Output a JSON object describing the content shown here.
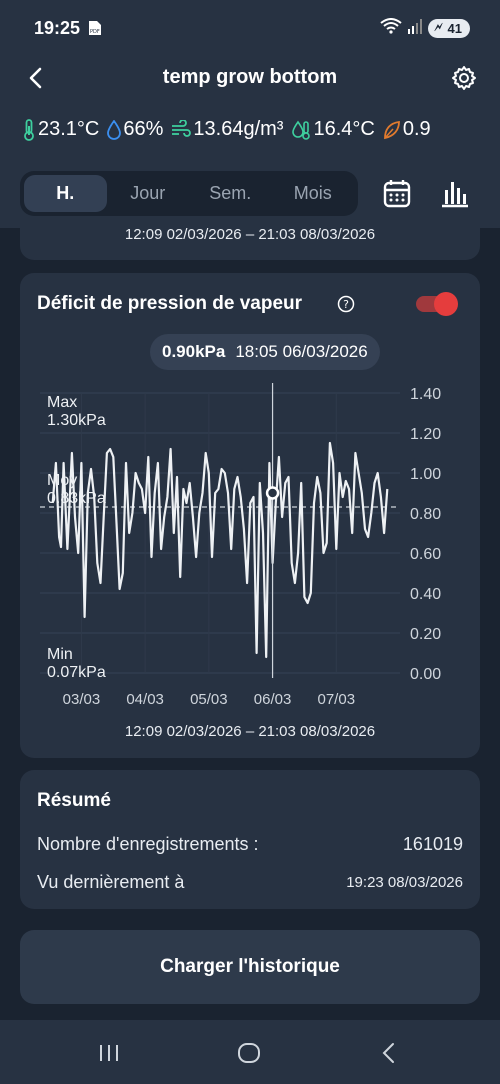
{
  "status": {
    "time": "19:25",
    "battery": "41"
  },
  "header": {
    "title": "temp grow bottom"
  },
  "metrics": {
    "temperature": "23.1°C",
    "humidity": "66%",
    "absolute_humidity": "13.64g/m³",
    "dew_point": "16.4°C",
    "vpd": "0.9"
  },
  "tabs": [
    {
      "label": "H."
    },
    {
      "label": "Jour"
    },
    {
      "label": "Sem."
    },
    {
      "label": "Mois"
    }
  ],
  "top_card": {
    "range": "12:09 02/03/2026 – 21:03 08/03/2026"
  },
  "chart_card": {
    "title": "Déficit de pression de vapeur",
    "tooltip_value": "0.90kPa",
    "tooltip_time": "18:05 06/03/2026",
    "range": "12:09 02/03/2026 – 21:03 08/03/2026"
  },
  "chart_data": {
    "type": "line",
    "ylim": [
      0,
      1.4
    ],
    "yticks": [
      "0.00",
      "0.20",
      "0.40",
      "0.60",
      "0.80",
      "1.00",
      "1.20",
      "1.40"
    ],
    "xticks": [
      "03/03",
      "04/03",
      "05/03",
      "06/03",
      "07/03"
    ],
    "annotations": {
      "max_label": "Max",
      "max_value": "1.30kPa",
      "avg_label": "Moy",
      "avg_value": "0.83kPa",
      "min_label": "Min",
      "min_value": "0.07kPa"
    },
    "average": 0.83,
    "cursor_x": 3.0,
    "cursor_value": 0.9,
    "x": [
      -0.45,
      -0.4,
      -0.35,
      -0.32,
      -0.28,
      -0.22,
      -0.15,
      -0.1,
      -0.05,
      0.0,
      0.05,
      0.1,
      0.15,
      0.2,
      0.25,
      0.3,
      0.35,
      0.4,
      0.45,
      0.5,
      0.55,
      0.6,
      0.65,
      0.7,
      0.75,
      0.8,
      0.85,
      0.9,
      0.95,
      1.0,
      1.05,
      1.1,
      1.15,
      1.2,
      1.25,
      1.3,
      1.35,
      1.4,
      1.45,
      1.5,
      1.55,
      1.6,
      1.65,
      1.7,
      1.75,
      1.8,
      1.85,
      1.9,
      1.95,
      2.0,
      2.05,
      2.1,
      2.15,
      2.2,
      2.25,
      2.3,
      2.35,
      2.4,
      2.45,
      2.5,
      2.55,
      2.6,
      2.65,
      2.7,
      2.75,
      2.8,
      2.85,
      2.9,
      2.95,
      3.0,
      3.05,
      3.1,
      3.15,
      3.2,
      3.25,
      3.3,
      3.35,
      3.4,
      3.45,
      3.5,
      3.55,
      3.6,
      3.65,
      3.7,
      3.75,
      3.8,
      3.85,
      3.9,
      3.95,
      4.0,
      4.05,
      4.1,
      4.15,
      4.2,
      4.25,
      4.3,
      4.35,
      4.4,
      4.45,
      4.5,
      4.55,
      4.6,
      4.65,
      4.7,
      4.75,
      4.8,
      4.85
    ],
    "y": [
      0.85,
      1.05,
      0.68,
      0.63,
      1.05,
      0.62,
      1.1,
      0.78,
      0.6,
      1.05,
      0.28,
      0.9,
      1.02,
      0.88,
      0.55,
      0.45,
      0.78,
      1.1,
      1.12,
      1.08,
      0.75,
      0.42,
      0.5,
      1.05,
      0.7,
      0.8,
      1.0,
      0.95,
      0.92,
      0.8,
      1.08,
      0.58,
      0.9,
      1.05,
      0.62,
      0.78,
      0.88,
      1.12,
      0.7,
      0.98,
      0.48,
      0.92,
      0.85,
      0.95,
      0.78,
      0.58,
      0.8,
      0.9,
      1.1,
      1.0,
      0.58,
      0.9,
      0.92,
      1.02,
      1.0,
      0.9,
      0.62,
      0.92,
      0.98,
      0.88,
      0.72,
      0.45,
      0.85,
      0.88,
      0.1,
      0.95,
      0.7,
      0.08,
      1.05,
      0.55,
      0.85,
      1.08,
      0.78,
      0.95,
      0.98,
      0.55,
      0.45,
      0.6,
      0.95,
      0.38,
      0.35,
      0.4,
      0.85,
      0.98,
      0.9,
      0.6,
      0.65,
      1.15,
      1.05,
      0.62,
      1.0,
      0.88,
      0.96,
      0.92,
      0.7,
      1.1,
      1.0,
      0.9,
      0.72,
      0.68,
      0.8,
      0.95,
      1.0,
      0.88,
      0.7,
      0.92
    ]
  },
  "summary": {
    "title": "Résumé",
    "records_label": "Nombre d'enregistrements :",
    "records_value": "161019",
    "last_seen_label": "Vu dernièrement à",
    "last_seen_value": "19:23 08/03/2026"
  },
  "load_button": {
    "label": "Charger l'historique"
  },
  "colors": {
    "background": "#1a2330",
    "card": "#273242",
    "accent_red": "#e53d3d",
    "temp_icon": "#3ecf9e",
    "humidity_icon": "#3b8ff0",
    "vpd_icon": "#e07a2e"
  }
}
